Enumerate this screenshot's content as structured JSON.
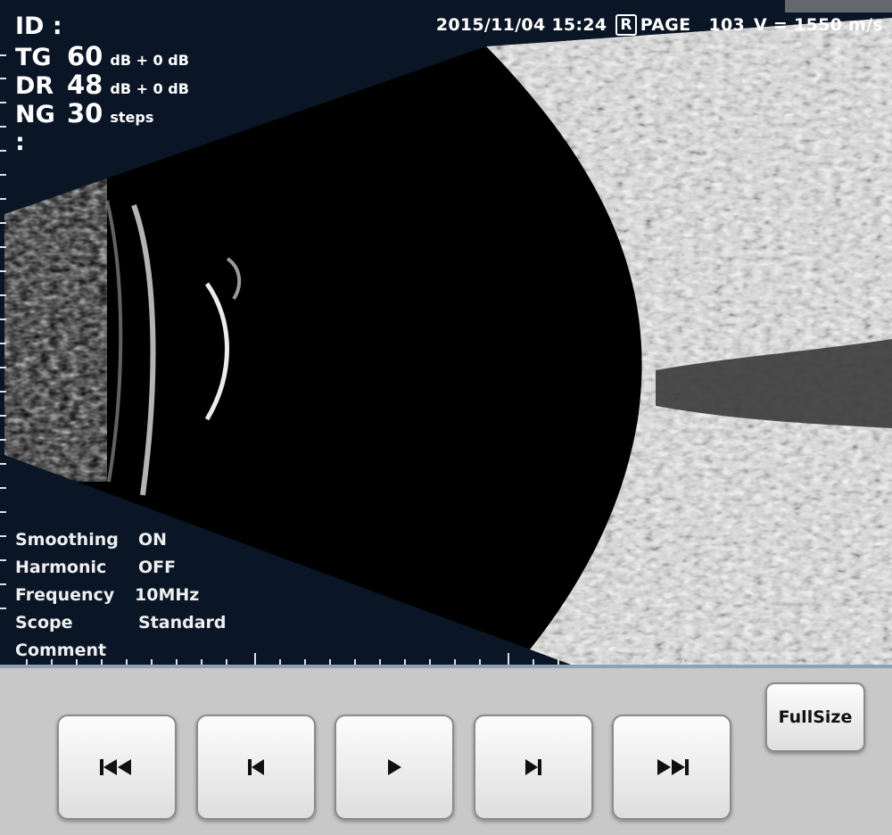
{
  "header": {
    "datetime": "2015/11/04 15:24",
    "side_badge": "R",
    "page_label": "PAGE",
    "page_number": "103",
    "velocity": "V = 1550 m/s"
  },
  "params": {
    "id_label": "ID :",
    "tg": {
      "key": "TG :",
      "value": "60",
      "unit": "dB + 0 dB"
    },
    "dr": {
      "key": "DR :",
      "value": "48",
      "unit": "dB + 0 dB"
    },
    "ng": {
      "key": "NG :",
      "value": "30",
      "unit": "steps"
    }
  },
  "settings": [
    {
      "key": "Smoothing",
      "value": "ON"
    },
    {
      "key": "Harmonic",
      "value": "OFF"
    },
    {
      "key": "Frequency",
      "value": "10MHz"
    },
    {
      "key": "Scope",
      "value": "Standard"
    },
    {
      "key": "Comment",
      "value": ""
    }
  ],
  "controls": {
    "fullsize_label": "FullSize",
    "icons": [
      "skip-to-first-icon",
      "step-back-icon",
      "play-icon",
      "step-forward-icon",
      "skip-to-last-icon"
    ]
  },
  "colors": {
    "screen_bg": "#0a1526",
    "panel_bg": "#c8c8c8",
    "panel_border": "#8fa2b5"
  }
}
